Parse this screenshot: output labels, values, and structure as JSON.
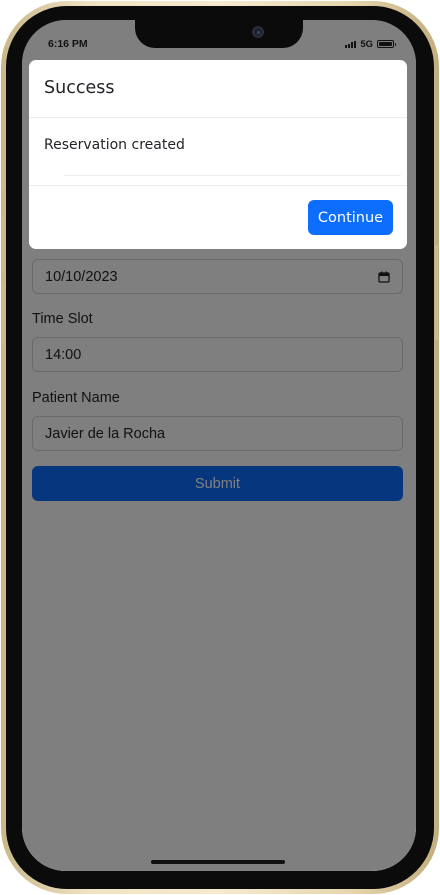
{
  "status_bar": {
    "time": "6:16 PM",
    "network": "5G"
  },
  "form": {
    "date_value": "10/10/2023",
    "time_slot_label": "Time Slot",
    "time_slot_value": "14:00",
    "patient_name_label": "Patient Name",
    "patient_name_value": "Javier de la Rocha",
    "submit_label": "Submit"
  },
  "modal": {
    "title": "Success",
    "body": "Reservation created",
    "continue_label": "Continue"
  },
  "colors": {
    "primary": "#0d6efd",
    "frame": "#e9dcb8"
  },
  "icons": [
    "signal-icon",
    "battery-icon",
    "calendar-icon",
    "camera-icon"
  ]
}
